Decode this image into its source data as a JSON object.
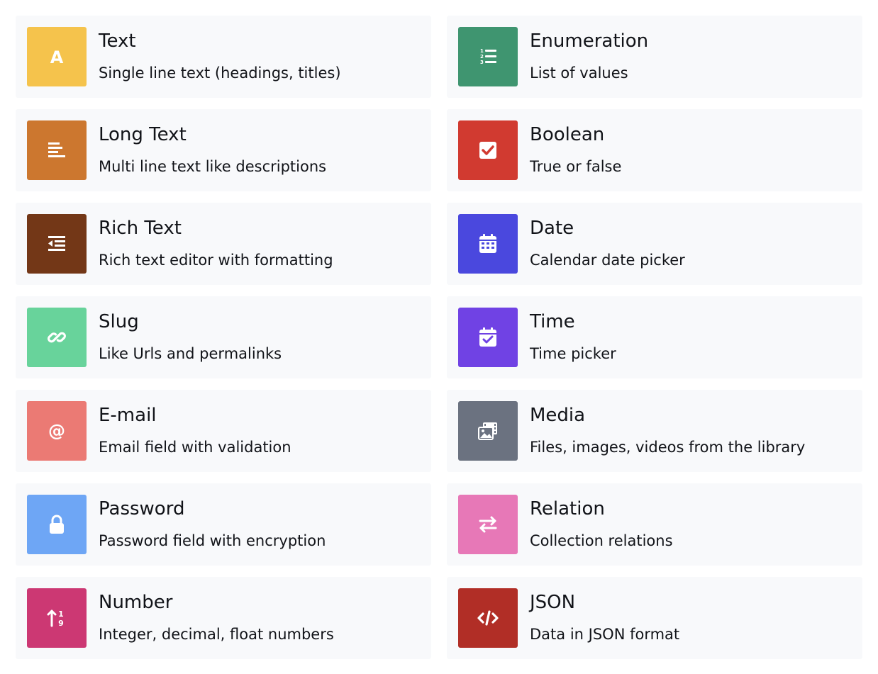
{
  "field_types": [
    {
      "title": "Text",
      "description": "Single line text (headings, titles)",
      "color": "#f5c34c",
      "icon": "text-a-icon"
    },
    {
      "title": "Enumeration",
      "description": "List of values",
      "color": "#3f9570",
      "icon": "numbered-list-icon"
    },
    {
      "title": "Long Text",
      "description": "Multi line text like descriptions",
      "color": "#cc772f",
      "icon": "align-left-icon"
    },
    {
      "title": "Boolean",
      "description": "True or false",
      "color": "#d13a30",
      "icon": "checkbox-icon"
    },
    {
      "title": "Rich Text",
      "description": "Rich text editor with formatting",
      "color": "#733717",
      "icon": "indent-list-icon"
    },
    {
      "title": "Date",
      "description": "Calendar date picker",
      "color": "#4a48de",
      "icon": "calendar-icon"
    },
    {
      "title": "Slug",
      "description": "Like Urls and permalinks",
      "color": "#68d39b",
      "icon": "link-icon"
    },
    {
      "title": "Time",
      "description": "Time picker",
      "color": "#7042e4",
      "icon": "calendar-check-icon"
    },
    {
      "title": "E-mail",
      "description": "Email field with validation",
      "color": "#eb7a74",
      "icon": "at-sign-icon"
    },
    {
      "title": "Media",
      "description": "Files, images, videos from the library",
      "color": "#6b7280",
      "icon": "media-icon"
    },
    {
      "title": "Password",
      "description": "Password field with encryption",
      "color": "#6ea6f5",
      "icon": "lock-icon"
    },
    {
      "title": "Relation",
      "description": "Collection relations",
      "color": "#e778b7",
      "icon": "arrows-exchange-icon"
    },
    {
      "title": "Number",
      "description": "Integer, decimal, float numbers",
      "color": "#cc3873",
      "icon": "sort-number-icon"
    },
    {
      "title": "JSON",
      "description": "Data in JSON format",
      "color": "#b12e26",
      "icon": "code-icon"
    }
  ]
}
